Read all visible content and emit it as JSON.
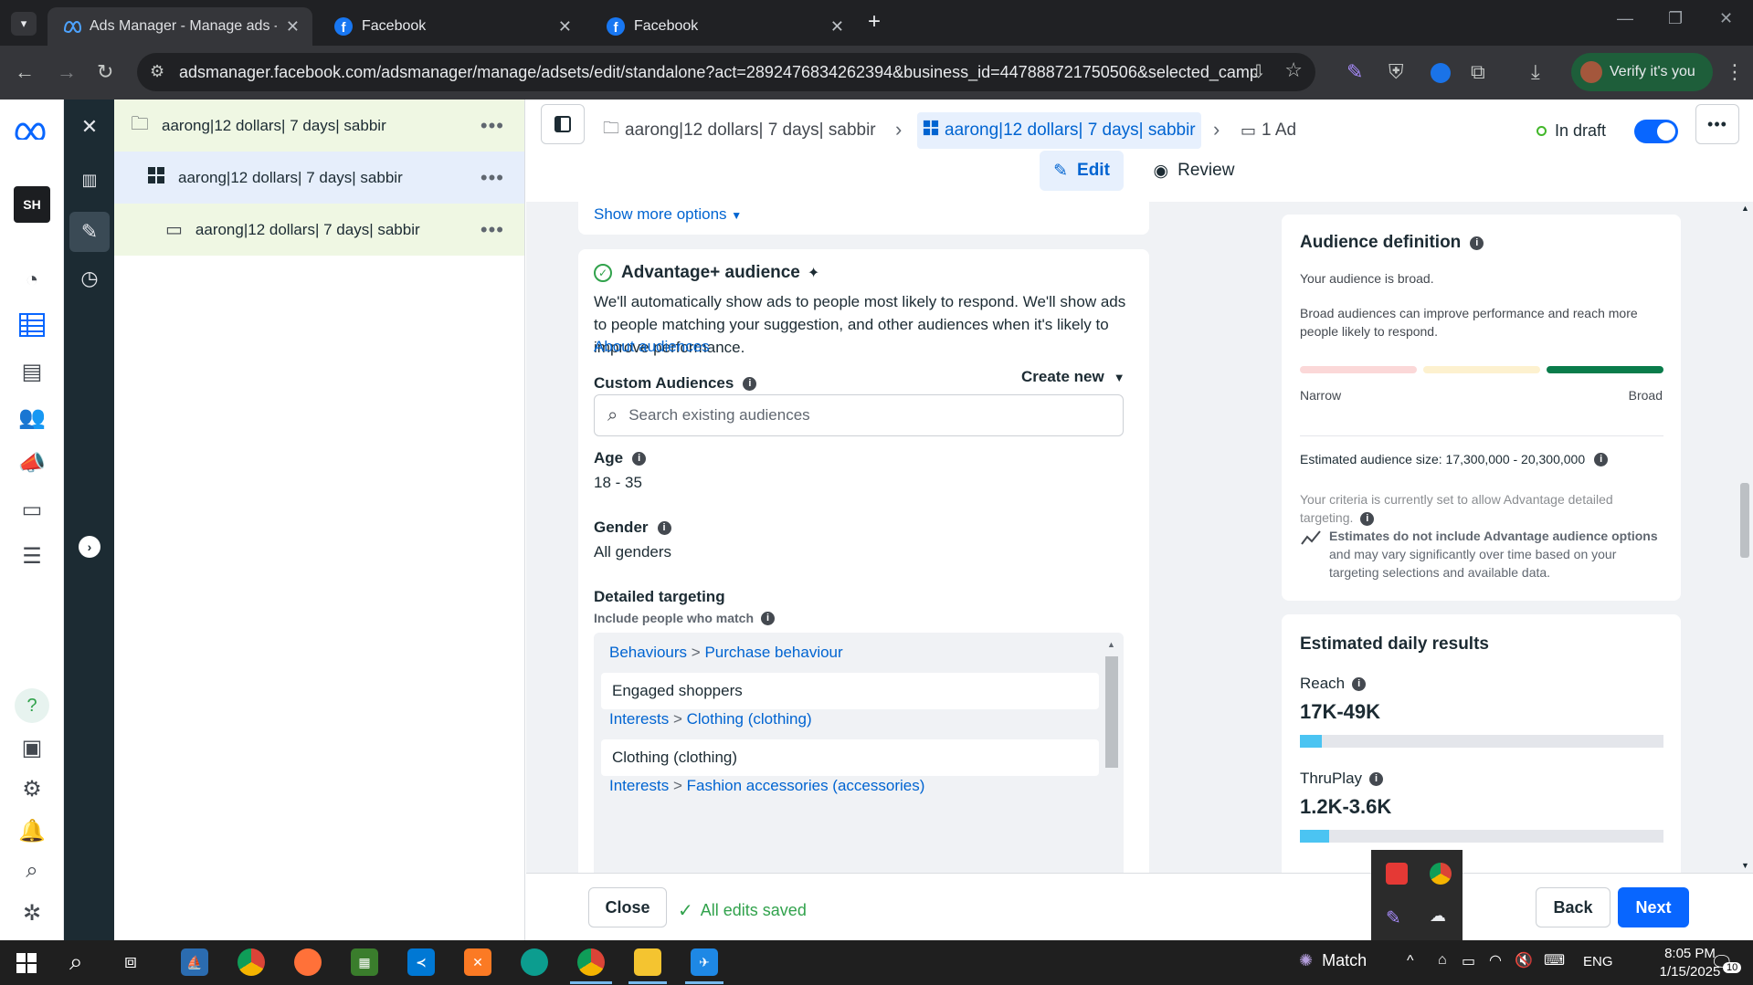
{
  "browser": {
    "tabs": [
      {
        "title": "Ads Manager - Manage ads - A",
        "active": true
      },
      {
        "title": "Facebook",
        "active": false
      },
      {
        "title": "Facebook",
        "active": false
      }
    ],
    "url": "adsmanager.facebook.com/adsmanager/manage/adsets/edit/standalone?act=2892476834262394&business_id=447888721750506&selected_campa...",
    "verify_label": "Verify it's you"
  },
  "rail": {
    "logo": "SH"
  },
  "tree": {
    "campaign": "aarong|12 dollars| 7 days| sabbir",
    "adset": "aarong|12 dollars| 7 days| sabbir",
    "ad": "aarong|12 dollars| 7 days| sabbir"
  },
  "header": {
    "crumb_campaign": "aarong|12 dollars| 7 days| sabbir",
    "crumb_adset": "aarong|12 dollars| 7 days| sabbir",
    "crumb_ad": "1 Ad",
    "status": "In draft",
    "edit_label": "Edit",
    "review_label": "Review"
  },
  "audience": {
    "show_more": "Show more options",
    "title": "Advantage+ audience",
    "description": "We'll automatically show ads to people most likely to respond. We'll show ads to people matching your suggestion, and other audiences when it's likely to improve performance.",
    "about_link": "About audiences",
    "custom_label": "Custom Audiences",
    "create_new": "Create new",
    "search_placeholder": "Search existing audiences",
    "age_label": "Age",
    "age_value": "18 - 35",
    "gender_label": "Gender",
    "gender_value": "All genders",
    "targeting_label": "Detailed targeting",
    "targeting_sub": "Include people who match",
    "targeting": [
      {
        "cat1": "Behaviours",
        "cat2": "Purchase behaviour",
        "item": "Engaged shoppers"
      },
      {
        "cat1": "Interests",
        "cat2": "Clothing (clothing)",
        "item": "Clothing (clothing)"
      },
      {
        "cat1": "Interests",
        "cat2": "Fashion accessories (accessories)",
        "item": ""
      }
    ]
  },
  "definition": {
    "title": "Audience definition",
    "broad_line": "Your audience is broad.",
    "broad_desc": "Broad audiences can improve performance and reach more people likely to respond.",
    "narrow": "Narrow",
    "broad": "Broad",
    "size": "Estimated audience size: 17,300,000 - 20,300,000",
    "criteria": "Your criteria is currently set to allow Advantage detailed targeting.",
    "estimates_bold": "Estimates do not include Advantage audience options",
    "estimates_rest": " and may vary significantly over time based on your targeting selections and available data."
  },
  "results": {
    "title": "Estimated daily results",
    "reach_label": "Reach",
    "reach_value": "17K-49K",
    "reach_fill": 0.06,
    "thruplay_label": "ThruPlay",
    "thruplay_value": "1.2K-3.6K",
    "thruplay_fill": 0.08
  },
  "footer": {
    "close": "Close",
    "saved": "All edits saved",
    "back": "Back",
    "next": "Next"
  },
  "taskbar": {
    "match": "Match",
    "lang": "ENG",
    "time": "8:05 PM",
    "date": "1/15/2025",
    "notif": "10"
  },
  "colors": {
    "accent": "#0064d1",
    "primary_button": "#0866ff",
    "broad_bar": "#0a7c4b",
    "result_bar": "#4bc4f2",
    "status_dot": "#42b72a"
  }
}
